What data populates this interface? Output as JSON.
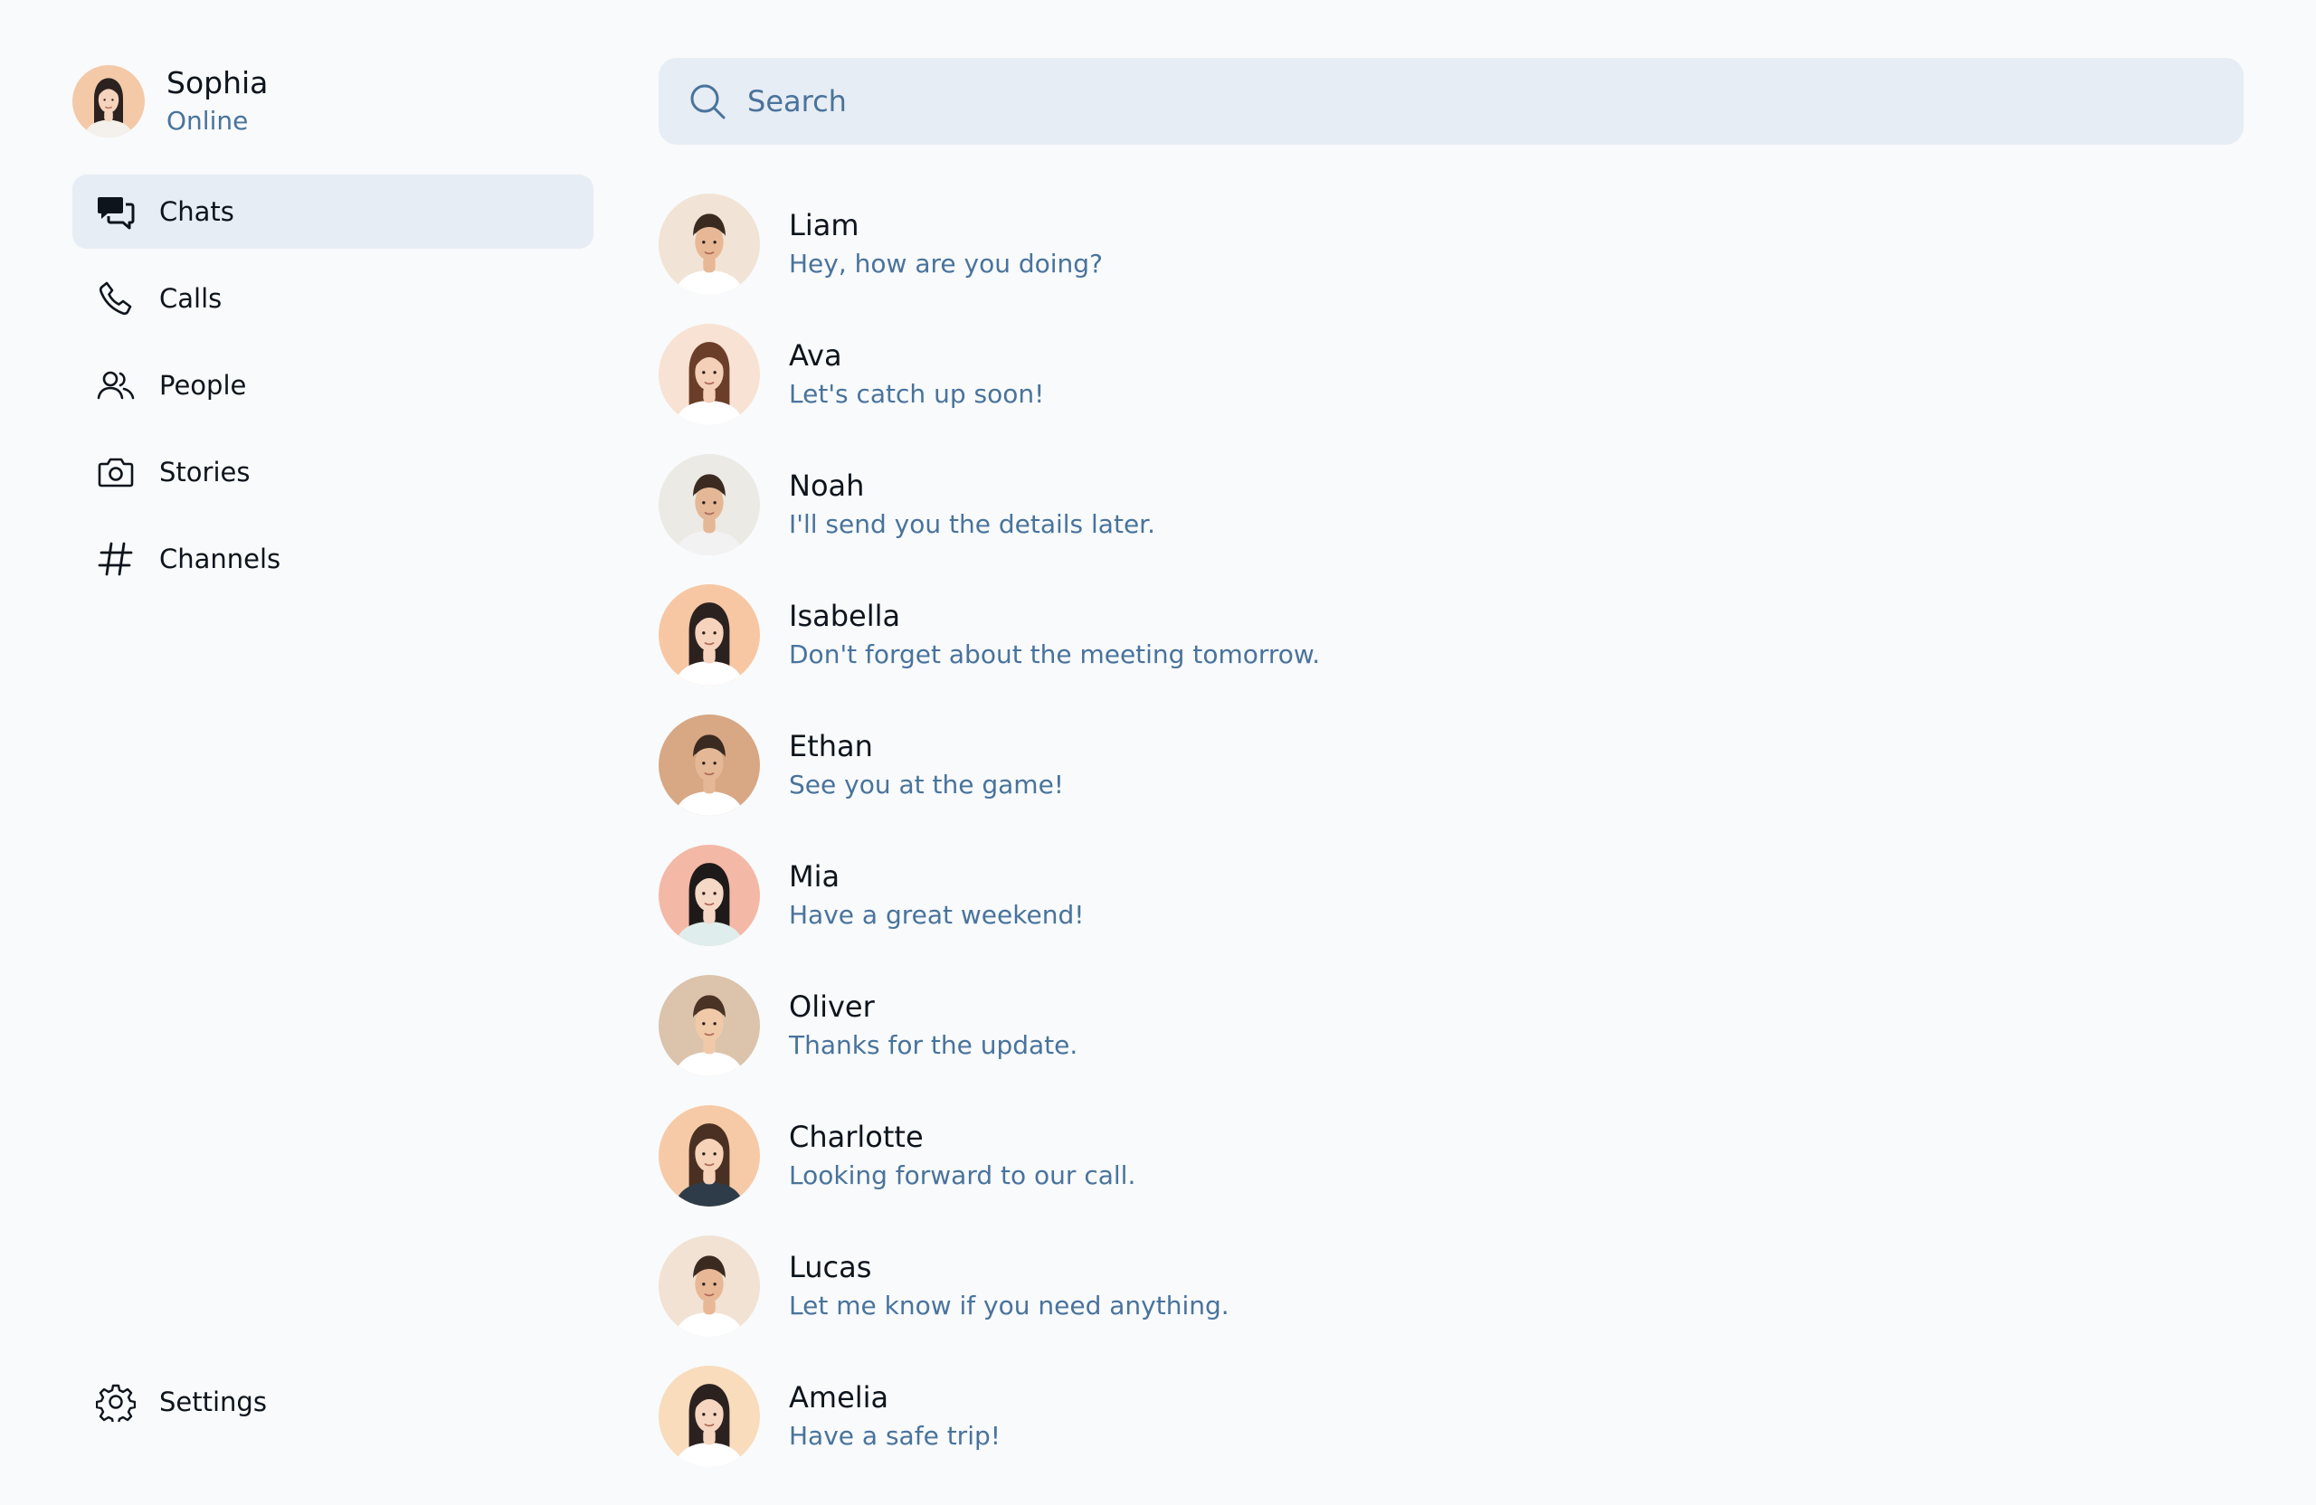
{
  "profile": {
    "name": "Sophia",
    "status": "Online",
    "avatar_colors": {
      "bg": "#f3c9a8",
      "skin": "#f6d3bc",
      "hair": "#2b2220",
      "shirt": "#f4f1ec"
    }
  },
  "nav": {
    "items": [
      {
        "label": "Chats",
        "icon": "chat-bubbles-icon",
        "active": true
      },
      {
        "label": "Calls",
        "icon": "phone-icon",
        "active": false
      },
      {
        "label": "People",
        "icon": "people-icon",
        "active": false
      },
      {
        "label": "Stories",
        "icon": "camera-icon",
        "active": false
      },
      {
        "label": "Channels",
        "icon": "hashtag-icon",
        "active": false
      }
    ],
    "settings_label": "Settings",
    "settings_icon": "gear-icon"
  },
  "search": {
    "placeholder": "Search",
    "icon": "search-icon"
  },
  "chats": [
    {
      "name": "Liam",
      "message": "Hey, how are you doing?",
      "avatar": {
        "bg": "#f1e4d6",
        "skin": "#e8b896",
        "hair": "#3a2a20",
        "shirt": "#ffffff",
        "long_hair": false
      }
    },
    {
      "name": "Ava",
      "message": "Let's catch up soon!",
      "avatar": {
        "bg": "#f8e2d4",
        "skin": "#f5d0b8",
        "hair": "#6a3e28",
        "shirt": "#ffffff",
        "long_hair": true
      }
    },
    {
      "name": "Noah",
      "message": "I'll send you the details later.",
      "avatar": {
        "bg": "#eceae4",
        "skin": "#e4b896",
        "hair": "#3a2a20",
        "shirt": "#f2f2f2",
        "long_hair": false
      }
    },
    {
      "name": "Isabella",
      "message": "Don't forget about the meeting tomorrow.",
      "avatar": {
        "bg": "#f7c7a4",
        "skin": "#f6d3bc",
        "hair": "#2b2220",
        "shirt": "#ffffff",
        "long_hair": true
      }
    },
    {
      "name": "Ethan",
      "message": "See you at the game!",
      "avatar": {
        "bg": "#d8a784",
        "skin": "#e4b896",
        "hair": "#3a2a20",
        "shirt": "#ffffff",
        "long_hair": false
      }
    },
    {
      "name": "Mia",
      "message": "Have a great weekend!",
      "avatar": {
        "bg": "#f4b8a6",
        "skin": "#f6d8c6",
        "hair": "#1f1a1a",
        "shirt": "#dfeeec",
        "long_hair": true
      }
    },
    {
      "name": "Oliver",
      "message": "Thanks for the update.",
      "avatar": {
        "bg": "#dbc3ac",
        "skin": "#f0caa8",
        "hair": "#4a3224",
        "shirt": "#ffffff",
        "long_hair": false
      }
    },
    {
      "name": "Charlotte",
      "message": "Looking forward to our call.",
      "avatar": {
        "bg": "#f6caa6",
        "skin": "#f5d2b8",
        "hair": "#4a3022",
        "shirt": "#2e3c4a",
        "long_hair": true
      }
    },
    {
      "name": "Lucas",
      "message": "Let me know if you need anything.",
      "avatar": {
        "bg": "#f1e2d4",
        "skin": "#e8b896",
        "hair": "#3a2a20",
        "shirt": "#ffffff",
        "long_hair": false
      }
    },
    {
      "name": "Amelia",
      "message": "Have a safe trip!",
      "avatar": {
        "bg": "#f8dcbc",
        "skin": "#f6d6c0",
        "hair": "#2b2220",
        "shirt": "#ffffff",
        "long_hair": true
      }
    }
  ],
  "colors": {
    "background": "#f8fafb",
    "active_nav": "#e7edf4",
    "search_bg": "#e7edf4",
    "secondary_text": "#49739c",
    "primary_text": "#0d141c"
  }
}
